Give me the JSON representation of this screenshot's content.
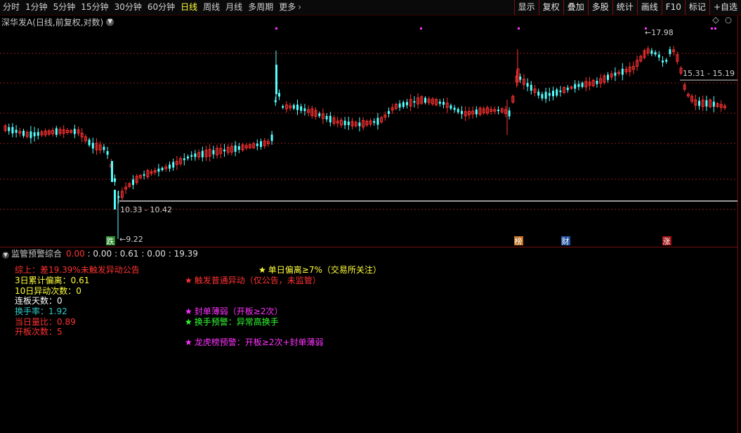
{
  "toolbar": {
    "tabs": [
      {
        "label": "分时",
        "active": false
      },
      {
        "label": "1分钟",
        "active": false
      },
      {
        "label": "5分钟",
        "active": false
      },
      {
        "label": "15分钟",
        "active": false
      },
      {
        "label": "30分钟",
        "active": false
      },
      {
        "label": "60分钟",
        "active": false
      },
      {
        "label": "日线",
        "active": true
      },
      {
        "label": "周线",
        "active": false
      },
      {
        "label": "月线",
        "active": false
      },
      {
        "label": "多周期",
        "active": false
      },
      {
        "label": "更多",
        "active": false
      }
    ],
    "buttons": [
      "显示",
      "复权",
      "叠加",
      "多股",
      "统计",
      "画线",
      "F10",
      "标记",
      "+自选"
    ]
  },
  "stock": {
    "name": "深华发A",
    "period_info": "(日线,前复权,对数)"
  },
  "price_annotations": {
    "high": "17.98",
    "low": "9.22",
    "range_low_label": "10.33 - 10.42",
    "range_high_label": "15.31 - 15.19"
  },
  "markers": [
    {
      "label": "跌",
      "color": "#2a8a2a",
      "text_color": "#ffffff"
    },
    {
      "label": "榜",
      "color": "#c07020",
      "text_color": "#ffffff"
    },
    {
      "label": "财",
      "color": "#2050a0",
      "text_color": "#ffffff"
    },
    {
      "label": "涨",
      "color": "#a01010",
      "text_color": "#ffffff"
    }
  ],
  "indicator": {
    "name": "监管预警综合",
    "values": [
      "0.00",
      "0.00",
      "0.61",
      "0.00",
      "19.39"
    ]
  },
  "indicator_lines": [
    {
      "text": "综上：差19.39%未触发异动公告",
      "color": "#ff3232"
    },
    {
      "text": "3日累计偏离：0.61",
      "color": "#ffff3c"
    },
    {
      "text": "10日异动次数：0",
      "color": "#ffff3c"
    },
    {
      "text": "连板天数：0",
      "color": "#ffffff"
    },
    {
      "text": "换手率：1.92",
      "color": "#32c8c8"
    },
    {
      "text": "当日量比：0.89",
      "color": "#ff3232"
    },
    {
      "text": "开板次数：5",
      "color": "#ff3232"
    }
  ],
  "warnings": [
    {
      "text": "单日偏离≥7%（交易所关注）",
      "color": "#ffff3c"
    },
    {
      "text": "触发普通异动（仅公告，未监管）",
      "color": "#ff3232"
    },
    {
      "text": "封单薄弱（开板≥2次）",
      "color": "#ff32ff"
    },
    {
      "text": "换手预警：异常高换手",
      "color": "#32ff32"
    },
    {
      "text": "龙虎榜预警：开板≥2次+封单薄弱",
      "color": "#ff32ff"
    }
  ],
  "colors": {
    "up": "#ff3232",
    "down": "#54ffff",
    "grid": "#8b1a1a",
    "bg": "#000000"
  }
}
